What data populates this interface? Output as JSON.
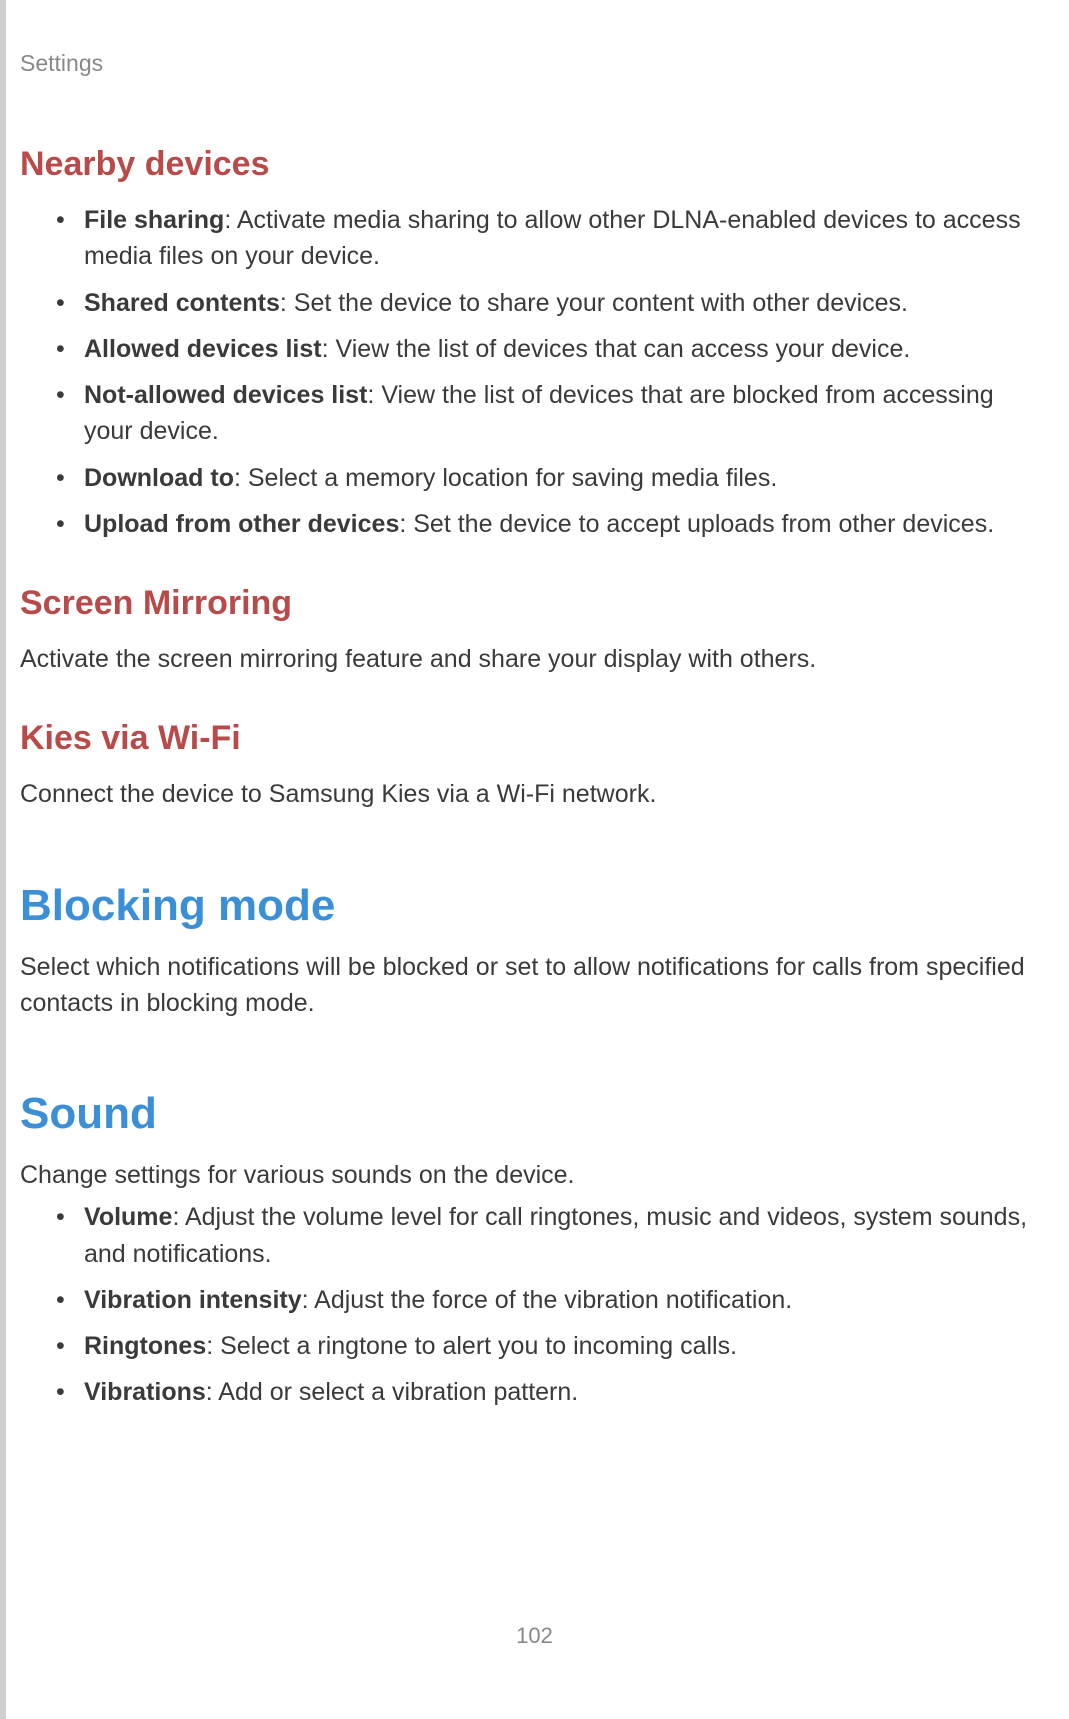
{
  "header": "Settings",
  "nearby": {
    "title": "Nearby devices",
    "items": [
      {
        "term": "File sharing",
        "desc": ": Activate media sharing to allow other DLNA-enabled devices to access media files on your device."
      },
      {
        "term": "Shared contents",
        "desc": ": Set the device to share your content with other devices."
      },
      {
        "term": "Allowed devices list",
        "desc": ": View the list of devices that can access your device."
      },
      {
        "term": "Not-allowed devices list",
        "desc": ": View the list of devices that are blocked from accessing your device."
      },
      {
        "term": "Download to",
        "desc": ": Select a memory location for saving media files."
      },
      {
        "term": "Upload from other devices",
        "desc": ": Set the device to accept uploads from other devices."
      }
    ]
  },
  "screen_mirroring": {
    "title": "Screen Mirroring",
    "body": "Activate the screen mirroring feature and share your display with others."
  },
  "kies": {
    "title": "Kies via Wi-Fi",
    "body": "Connect the device to Samsung Kies via a Wi-Fi network."
  },
  "blocking": {
    "title": "Blocking mode",
    "body": "Select which notifications will be blocked or set to allow notifications for calls from specified contacts in blocking mode."
  },
  "sound": {
    "title": "Sound",
    "body": "Change settings for various sounds on the device.",
    "items": [
      {
        "term": "Volume",
        "desc": ": Adjust the volume level for call ringtones, music and videos, system sounds, and notifications."
      },
      {
        "term": "Vibration intensity",
        "desc": ": Adjust the force of the vibration notification."
      },
      {
        "term": "Ringtones",
        "desc": ": Select a ringtone to alert you to incoming calls."
      },
      {
        "term": "Vibrations",
        "desc": ": Add or select a vibration pattern."
      }
    ]
  },
  "page_number": "102"
}
